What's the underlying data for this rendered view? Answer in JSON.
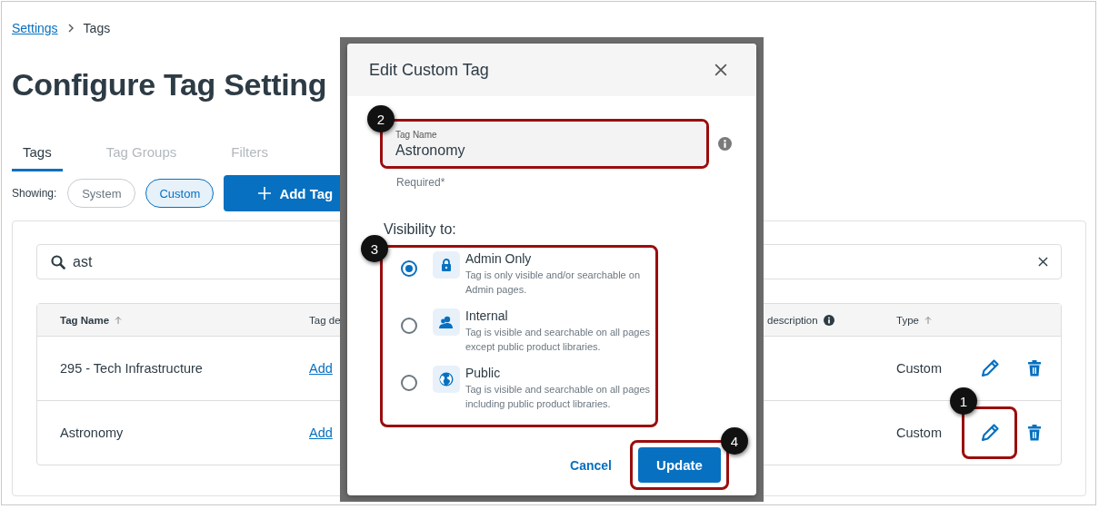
{
  "breadcrumb": [
    {
      "label": "Settings"
    },
    {
      "label": "Tags"
    }
  ],
  "page_title": "Configure Tag Setting",
  "tabs": [
    {
      "label": "Tags",
      "selected": true
    },
    {
      "label": "Tag Groups",
      "selected": false
    },
    {
      "label": "Filters",
      "selected": false
    }
  ],
  "filter": {
    "label": "Showing:",
    "options": [
      {
        "label": "System",
        "selected": false
      },
      {
        "label": "Custom",
        "selected": true
      }
    ]
  },
  "add_button": "Add Tag",
  "search": {
    "value": "ast"
  },
  "table": {
    "columns": [
      {
        "label": "Tag Name",
        "sortable": true
      },
      {
        "label": "Tag de"
      },
      {
        "label": "description",
        "info": true
      },
      {
        "label": "Type",
        "sortable": true
      }
    ],
    "rows": [
      {
        "name": "295 - Tech Infrastructure",
        "description_link": "Add",
        "type": "Custom"
      },
      {
        "name": "Astronomy",
        "description_link": "Add",
        "type": "Custom",
        "callout": "1"
      }
    ]
  },
  "modal": {
    "title": "Edit Custom Tag",
    "field": {
      "label": "Tag Name",
      "value": "Astronomy",
      "hint": "Required*",
      "callout": "2"
    },
    "visibility": {
      "label": "Visibility to:",
      "callout": "3",
      "options": [
        {
          "title": "Admin Only",
          "description": "Tag is only visible and/or searchable on Admin pages.",
          "selected": true
        },
        {
          "title": "Internal",
          "description": "Tag is visible and searchable on all pages except public product libraries.",
          "selected": false
        },
        {
          "title": "Public",
          "description": "Tag is visible and searchable on all pages including public product libraries.",
          "selected": false
        }
      ]
    },
    "buttons": [
      {
        "label": "Cancel",
        "kind": "link"
      },
      {
        "label": "Update",
        "kind": "primary",
        "callout": "4"
      }
    ]
  }
}
